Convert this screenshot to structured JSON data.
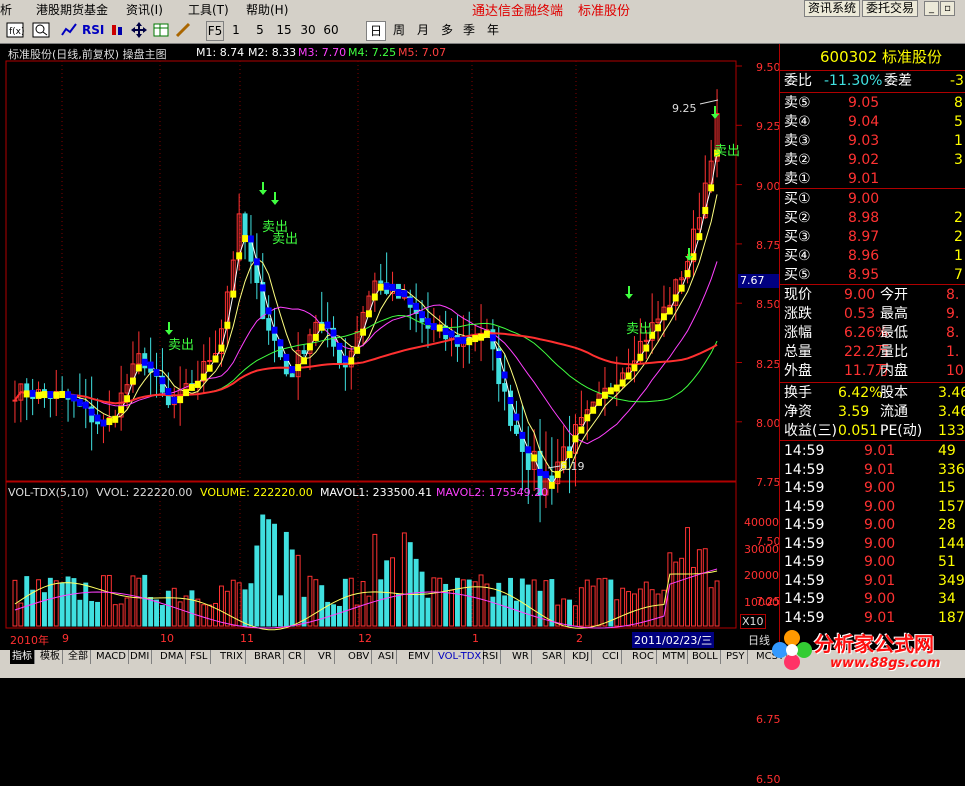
{
  "menu": {
    "items": [
      "析",
      "港股期货基金",
      "资讯(I)",
      "工具(T)",
      "帮助(H)"
    ],
    "app_title": "通达信金融终端",
    "stock_title": "标准股份",
    "btn_news": "资讯系统",
    "btn_trade": "委托交易"
  },
  "toolbar": {
    "periods": [
      "F5",
      "1",
      "5",
      "15",
      "30",
      "60",
      "日",
      "周",
      "月",
      "多",
      "季",
      "年"
    ],
    "selected": "日",
    "rsi": "RSI"
  },
  "chart": {
    "header_name": "标准股份(日线,前复权) 操盘主图",
    "ma": [
      {
        "label": "M1: 8.74",
        "color": "#ffffff"
      },
      {
        "label": "M2: 8.33",
        "color": "#ffffff"
      },
      {
        "label": "M3: 7.70",
        "color": "#ff40ff"
      },
      {
        "label": "M4: 7.25",
        "color": "#40ff40"
      },
      {
        "label": "M5: 7.07",
        "color": "#ff4040"
      }
    ],
    "price_axis": [
      "9.50",
      "9.25",
      "9.00",
      "8.75",
      "8.50",
      "8.25",
      "8.00",
      "7.75",
      "7.50",
      "7.25",
      "7.00",
      "6.75",
      "6.50"
    ],
    "current_price_tag": "7.67",
    "high_annotation": "9.25",
    "low_annotation": "6.19",
    "sell_label": "卖出",
    "vol_header": {
      "name": "VOL-TDX(5,10)",
      "vvol": "VVOL: 222220.00",
      "volume": "VOLUME: 222220.00",
      "mavol1": "MAVOL1: 233500.41",
      "mavol2": "MAVOL2: 175549.20"
    },
    "vol_axis": [
      "40000",
      "30000",
      "20000",
      "10000"
    ],
    "vol_unit": "X10",
    "time_axis": [
      "2010年",
      "9",
      "10",
      "11",
      "12",
      "1",
      "2"
    ],
    "date_tag": "2011/02/23/三",
    "day_tab": "日线"
  },
  "chart_data": {
    "type": "candlestick",
    "ylim": [
      6.19,
      9.25
    ],
    "high": 9.25,
    "low": 6.19,
    "sell_signals": [
      "卖出",
      "卖出",
      "卖出",
      "卖出",
      "卖出"
    ],
    "moving_averages": {
      "M1": 8.74,
      "M2": 8.33,
      "M3": 7.7,
      "M4": 7.25,
      "M5": 7.07
    },
    "volume": {
      "VVOL": 222220.0,
      "VOLUME": 222220.0,
      "MAVOL1": 233500.41,
      "MAVOL2": 175549.2
    },
    "vol_ylim": [
      0,
      40000
    ]
  },
  "quote": {
    "code_name": "600302 标准股份",
    "wb_label": "委比",
    "wb_value": "-11.30%",
    "wc_label": "委差",
    "wc_value": "-3",
    "asks": [
      {
        "l": "卖⑤",
        "p": "9.05",
        "v": "8"
      },
      {
        "l": "卖④",
        "p": "9.04",
        "v": "5"
      },
      {
        "l": "卖③",
        "p": "9.03",
        "v": "1"
      },
      {
        "l": "卖②",
        "p": "9.02",
        "v": "3"
      },
      {
        "l": "卖①",
        "p": "9.01",
        "v": ""
      }
    ],
    "bids": [
      {
        "l": "买①",
        "p": "9.00",
        "v": ""
      },
      {
        "l": "买②",
        "p": "8.98",
        "v": "2"
      },
      {
        "l": "买③",
        "p": "8.97",
        "v": "2"
      },
      {
        "l": "买④",
        "p": "8.96",
        "v": "1"
      },
      {
        "l": "买⑤",
        "p": "8.95",
        "v": "7"
      }
    ],
    "stats": [
      {
        "a": "现价",
        "b": "9.00",
        "c": "今开",
        "d": "8."
      },
      {
        "a": "涨跌",
        "b": "0.53",
        "c": "最高",
        "d": "9."
      },
      {
        "a": "涨幅",
        "b": "6.26%",
        "c": "最低",
        "d": "8."
      },
      {
        "a": "总量",
        "b": "22.2万",
        "c": "量比",
        "d": "1."
      },
      {
        "a": "外盘",
        "b": "11.7万",
        "c": "内盘",
        "d": "10.5"
      }
    ],
    "stats2": [
      {
        "a": "换手",
        "b": "6.42%",
        "c": "股本",
        "d": "3.46"
      },
      {
        "a": "净资",
        "b": "3.59",
        "c": "流通",
        "d": "3.46"
      },
      {
        "a": "收益(三)",
        "b": "0.051",
        "c": "PE(动)",
        "d": "133"
      }
    ],
    "ticks": [
      {
        "t": "14:59",
        "p": "9.01",
        "v": "49"
      },
      {
        "t": "14:59",
        "p": "9.01",
        "v": "336"
      },
      {
        "t": "14:59",
        "p": "9.00",
        "v": "15"
      },
      {
        "t": "14:59",
        "p": "9.00",
        "v": "157"
      },
      {
        "t": "14:59",
        "p": "9.00",
        "v": "28"
      },
      {
        "t": "14:59",
        "p": "9.00",
        "v": "144"
      },
      {
        "t": "14:59",
        "p": "9.00",
        "v": "51"
      },
      {
        "t": "14:59",
        "p": "9.01",
        "v": "349"
      },
      {
        "t": "14:59",
        "p": "9.00",
        "v": "34"
      },
      {
        "t": "14:59",
        "p": "9.01",
        "v": "187"
      }
    ]
  },
  "tabs": [
    "指标",
    "模板",
    "全部",
    "MACD",
    "DMI",
    "DMA",
    "FSL",
    "TRIX",
    "BRAR",
    "CR",
    "VR",
    "OBV",
    "ASI",
    "EMV",
    "VOL-TDX",
    "RSI",
    "WR",
    "SAR",
    "KDJ",
    "CCI",
    "ROC",
    "MTM",
    "BOLL",
    "PSY",
    "MCST"
  ],
  "tab_selected": "VOL-TDX",
  "watermark": {
    "text": "分析家公式网",
    "url": "www.88gs.com"
  }
}
